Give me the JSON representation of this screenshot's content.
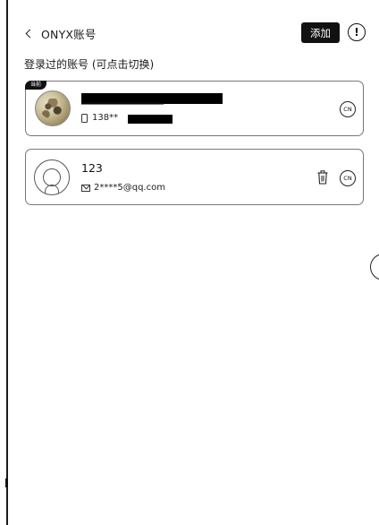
{
  "header": {
    "title": "ONYX账号",
    "add_label": "添加",
    "info_glyph": "!"
  },
  "section": {
    "title": "登录过的账号 (可点击切换)"
  },
  "accounts": [
    {
      "badge": "当前",
      "name": "",
      "contact_visible": "138**",
      "region": "CN"
    },
    {
      "badge": "",
      "name": "123",
      "contact_visible": "2****5@qq.com",
      "region": "CN"
    }
  ],
  "colors": {
    "button_bg": "#111111",
    "border": "#777777",
    "text": "#111111"
  },
  "icons": {
    "back": "chevron-left-icon",
    "info": "info-circle-icon",
    "phone": "phone-icon",
    "mail": "mail-icon",
    "trash": "trash-icon",
    "region": "cn-region-icon"
  }
}
